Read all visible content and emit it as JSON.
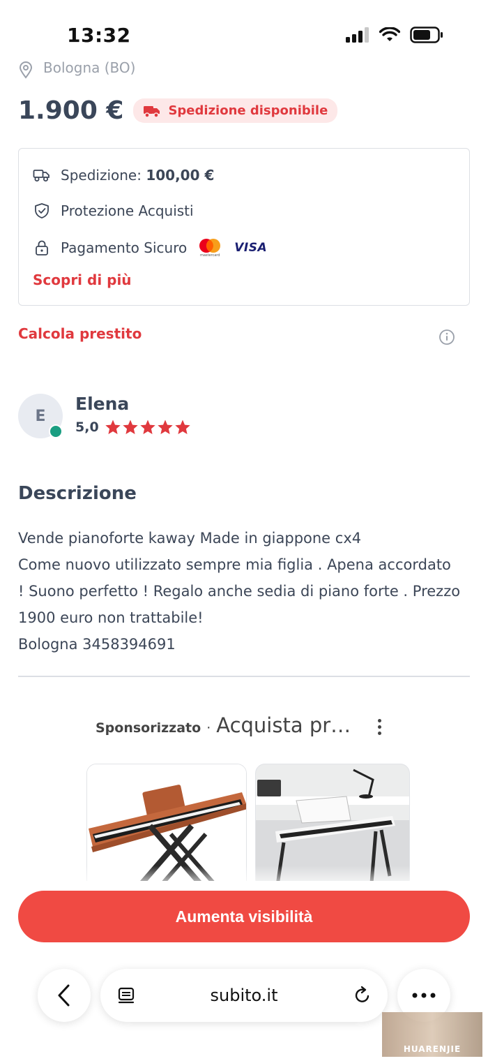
{
  "status_bar": {
    "time": "13:32"
  },
  "listing": {
    "location": "Bologna (BO)",
    "price": "1.900 €",
    "shipping_badge": "Spedizione disponibile"
  },
  "info_box": {
    "shipping_label": "Spedizione: ",
    "shipping_value": "100,00 €",
    "protection": "Protezione Acquisti",
    "payment": "Pagamento Sicuro",
    "mastercard_caption": "mastercard",
    "visa_label": "VISA",
    "more_link": "Scopri di più"
  },
  "loan_link": "Calcola prestito",
  "seller": {
    "initial": "E",
    "name": "Elena",
    "rating": "5,0",
    "stars": 5
  },
  "description": {
    "title": "Descrizione",
    "lines": [
      "Vende pianoforte kaway Made in giappone cx4",
      "Come nuovo utilizzato sempre mia figlia . Apena accordato",
      "! Suono perfetto ! Regalo anche sedia di piano forte . Prezzo",
      "1900 euro non trattabile!",
      "Bologna 3458394691"
    ]
  },
  "sponsored": {
    "label": "Sponsorizzato",
    "separator": "·",
    "title": "Acquista pr…"
  },
  "cta_label": "Aumenta visibilità",
  "browser": {
    "url": "subito.it"
  },
  "watermark": "HUARENJIE",
  "colors": {
    "accent": "#e0393e",
    "cta": "#f04a43",
    "online": "#1a9e82",
    "text": "#3a4659"
  }
}
